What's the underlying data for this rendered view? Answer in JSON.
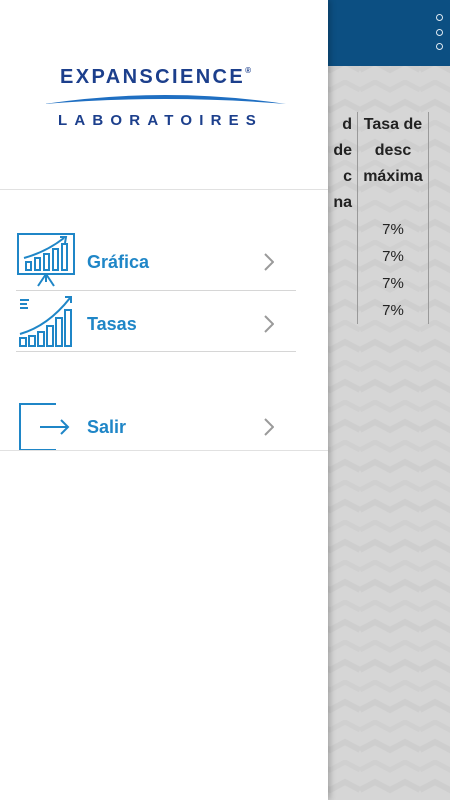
{
  "background": {
    "header_color": "#0c4f82",
    "overflow_icon": "more-vert-icon",
    "table": {
      "headers": [
        [
          "d de",
          "c",
          "na"
        ],
        [
          "Tasa de",
          "desc",
          "máxima"
        ]
      ],
      "rows": [
        "7%",
        "7%",
        "7%",
        "7%"
      ]
    }
  },
  "drawer": {
    "logo": {
      "name": "EXPANSCIENCE",
      "reg": "®",
      "subtitle": "LABORATOIRES"
    },
    "menu": [
      {
        "label": "Gráfica",
        "icon": "presentation-chart-icon"
      },
      {
        "label": "Tasas",
        "icon": "bar-chart-growth-icon"
      },
      {
        "label": "Salir",
        "icon": "logout-icon"
      }
    ],
    "accent_color": "#1f86c7",
    "brand_color": "#1c3f8c"
  }
}
